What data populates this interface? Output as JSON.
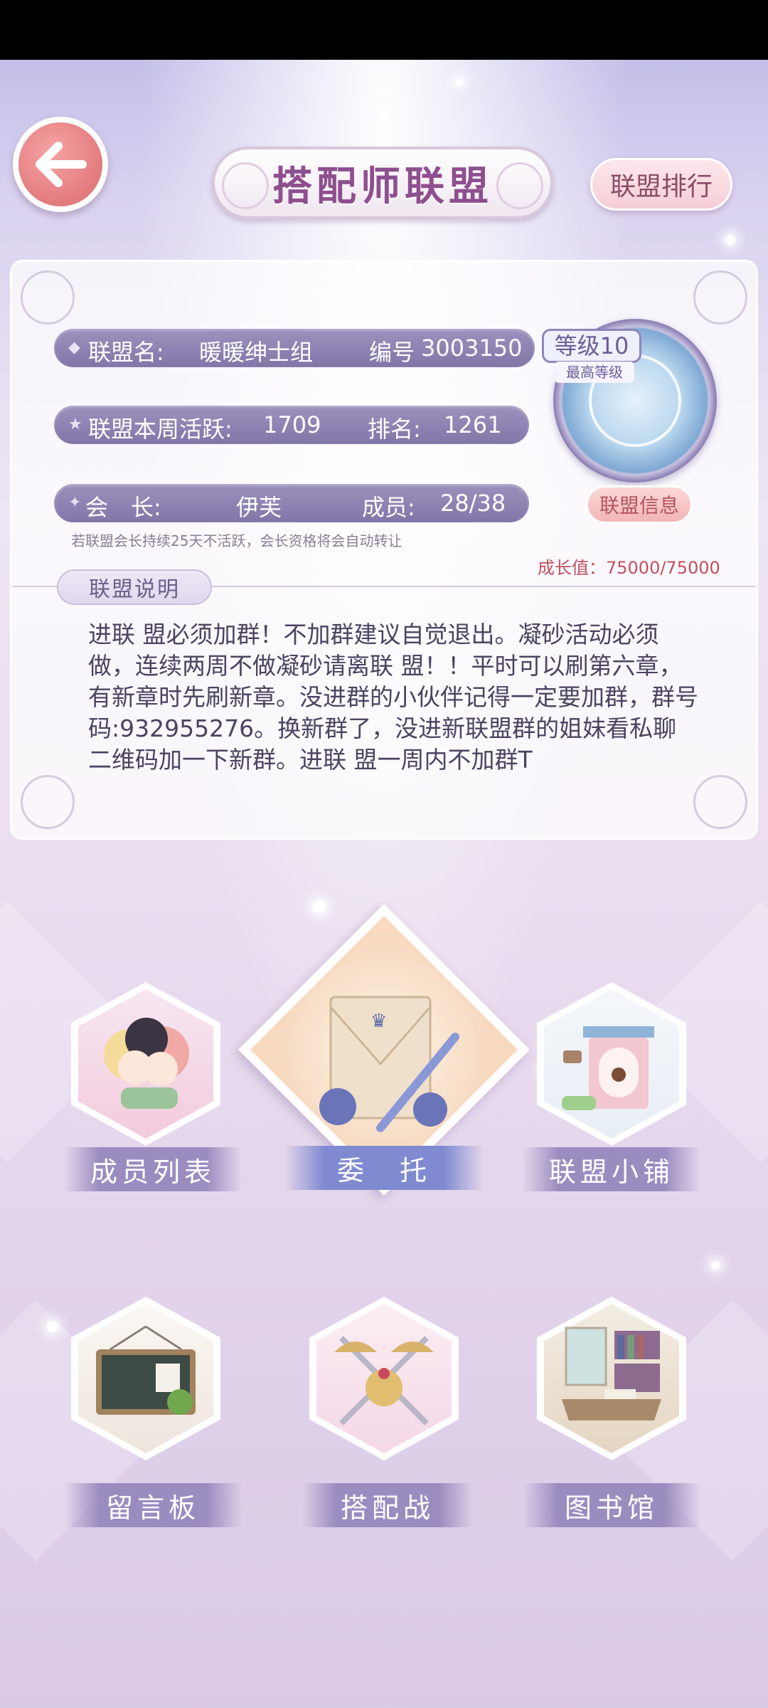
{
  "header": {
    "title": "搭配师联盟",
    "ranking_label": "联盟排行"
  },
  "alliance": {
    "name_label": "联盟名:",
    "name": "暖暖绅士组",
    "id_label": "编号",
    "id": "3003150",
    "weekly_active_label": "联盟本周活跃:",
    "weekly_active": "1709",
    "rank_label": "排名:",
    "rank": "1261",
    "leader_label": "会　长:",
    "leader": "伊芙",
    "members_label": "成员:",
    "members": "28/38",
    "level": "等级10",
    "level_note": "最高等级",
    "info_button": "联盟信息",
    "leader_note": "若联盟会长持续25天不活跃，会长资格将会自动转让",
    "growth": "成长值：75000/75000",
    "description_label": "联盟说明",
    "description": "进联 盟必须加群！不加群建议自觉退出。凝砂活动必须做，连续两周不做凝砂请离联 盟！！平时可以刷第六章，有新章时先刷新章。没进群的小伙伴记得一定要加群，群号码:932955276。换新群了，没进新联盟群的姐妹看私聊二维码加一下新群。进联 盟一周内不加群T"
  },
  "menu": {
    "members": "成员列表",
    "commission": "委　托",
    "shop": "联盟小铺",
    "message_board": "留言板",
    "battle": "搭配战",
    "library": "图书馆"
  },
  "colors": {
    "accent_purple": "#9b8cc0",
    "back_button": "#e27b7e",
    "growth_text": "#c0505e"
  }
}
